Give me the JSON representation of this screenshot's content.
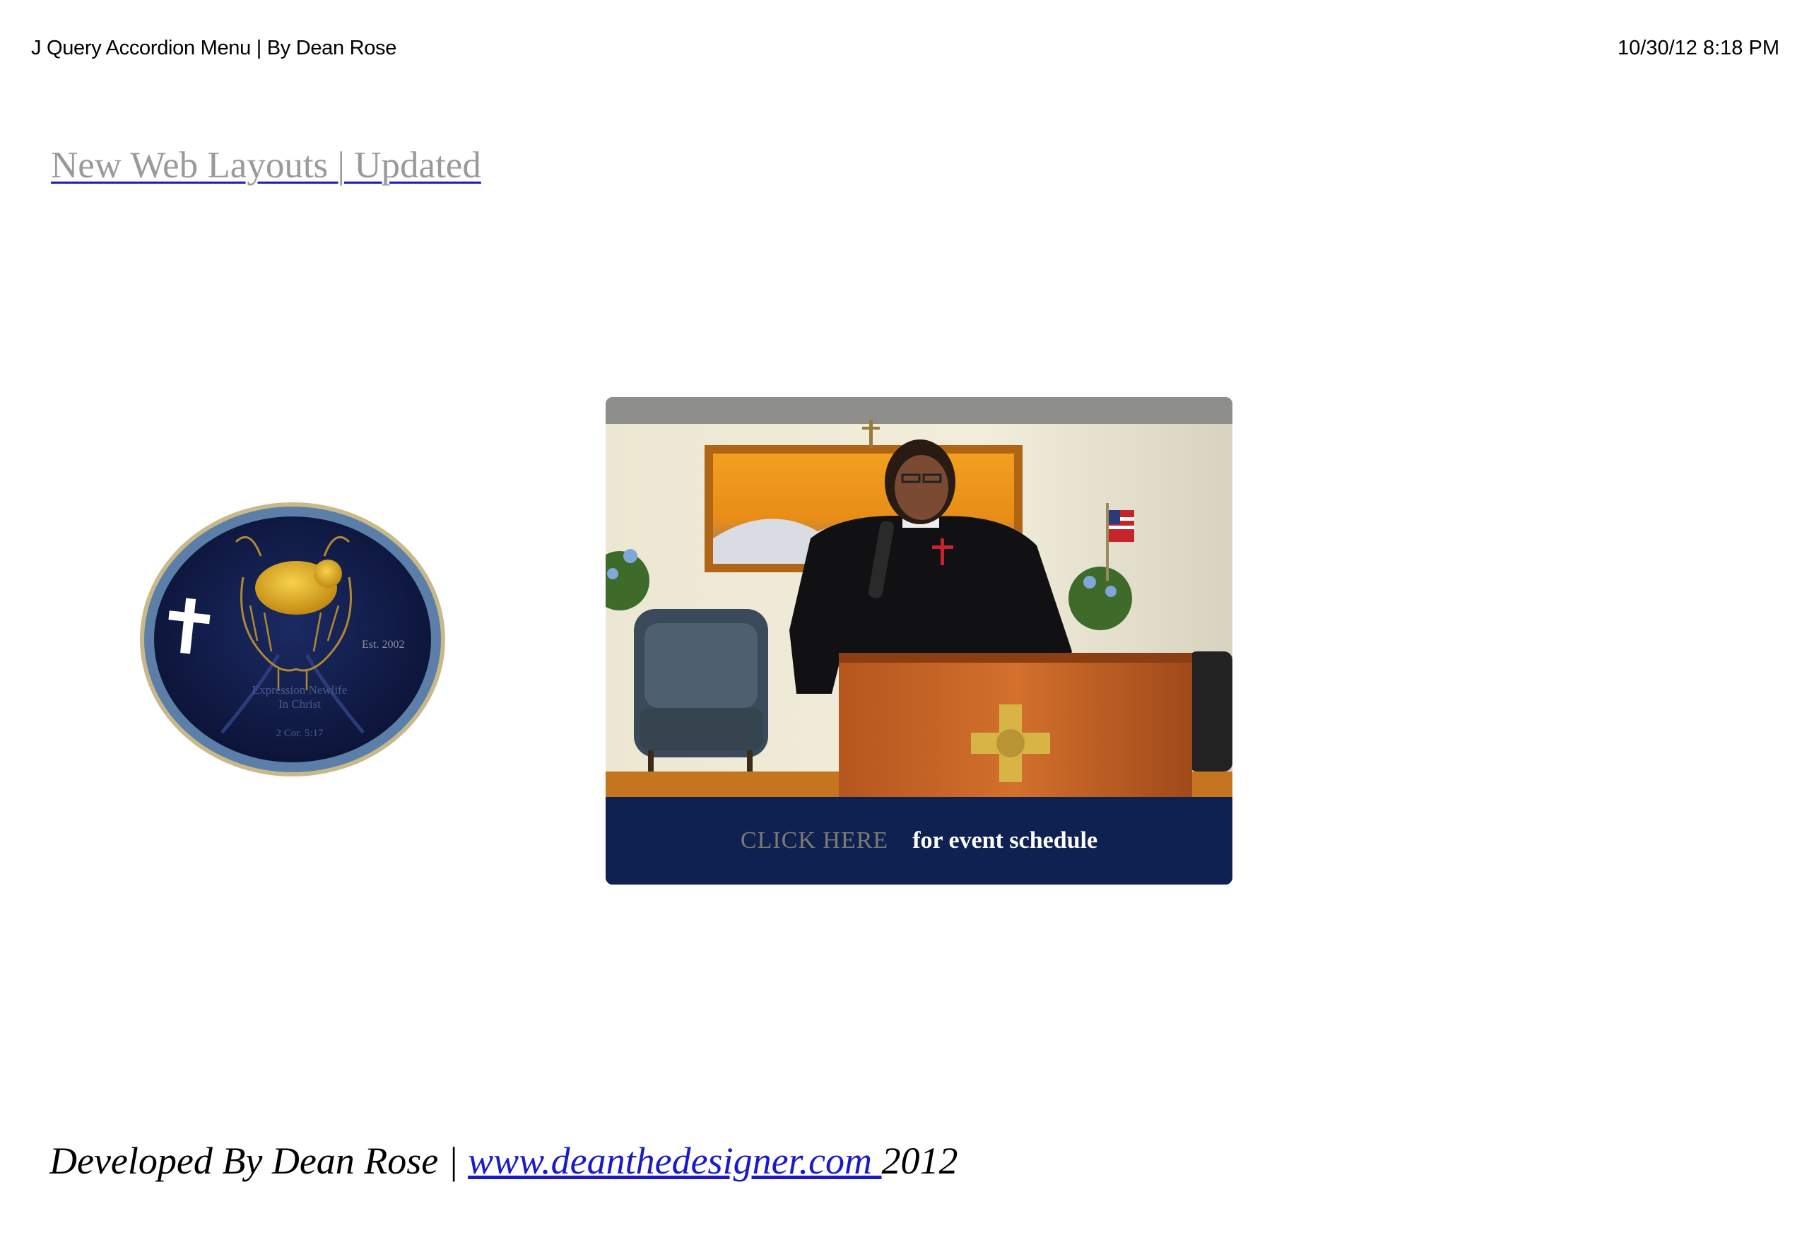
{
  "header": {
    "title": "J Query Accordion Menu | By Dean Rose",
    "datetime": "10/30/12 8:18 PM"
  },
  "nav": {
    "link_label": "New Web Layouts | Updated"
  },
  "banner": {
    "click_label": "CLICK HERE",
    "event_label": "for event schedule"
  },
  "footer": {
    "prefix": "Developed By Dean Rose | ",
    "link_text": "www.deanthedesigner.com ",
    "suffix": "2012"
  },
  "colors": {
    "link_underline": "#1a1acc",
    "banner_bar": "#0f2150",
    "seal_ring": "#5b7fa8",
    "seal_fill": "#101a45",
    "gold": "#d9a21b"
  }
}
